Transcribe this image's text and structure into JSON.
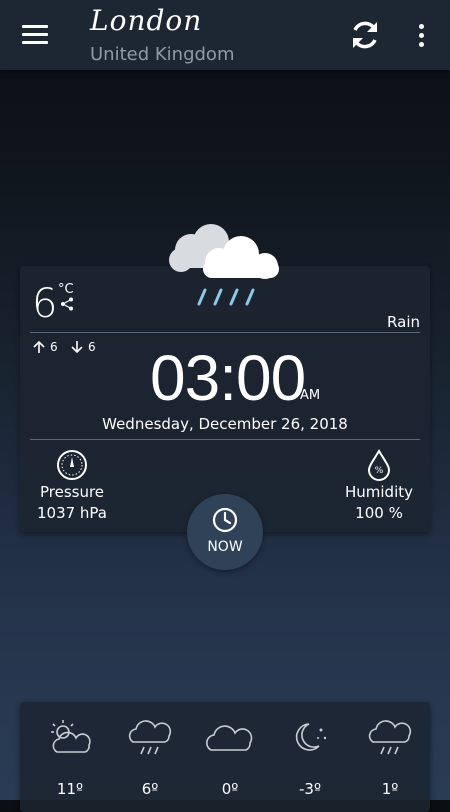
{
  "header": {
    "city": "London",
    "country": "United Kingdom"
  },
  "current": {
    "temperature": "6",
    "unit": "°C",
    "condition": "Rain",
    "high": "6",
    "low": "6",
    "time": "03:00",
    "ampm": "AM",
    "date": "Wednesday, December 26, 2018",
    "pressure_label": "Pressure",
    "pressure_value": "1037 hPa",
    "humidity_label": "Humidity",
    "humidity_value": "100 %",
    "now_label": "NOW"
  },
  "forecast": [
    {
      "icon": "partly-cloudy-day-icon",
      "temp": "11º"
    },
    {
      "icon": "rain-icon",
      "temp": "6º"
    },
    {
      "icon": "cloudy-icon",
      "temp": "0º"
    },
    {
      "icon": "clear-night-icon",
      "temp": "-3º"
    },
    {
      "icon": "rain-icon",
      "temp": "1º"
    }
  ],
  "colors": {
    "header_bg": "#1d2733",
    "card_bg": "#1c2530",
    "now_button": "#2f4258",
    "muted_text": "#8e9aa8",
    "rain_blue": "#8fc6ea"
  }
}
